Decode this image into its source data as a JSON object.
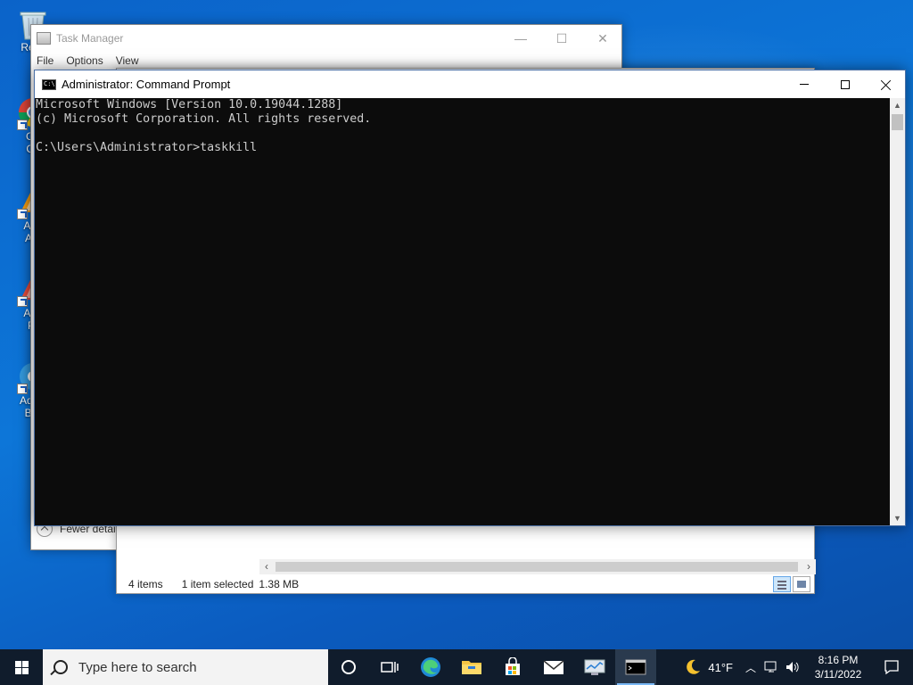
{
  "desktop": {
    "icons": [
      {
        "label": "Recy"
      },
      {
        "label": "Go",
        "label2": "Ch"
      },
      {
        "label": "Ada",
        "label2": "Ant"
      },
      {
        "label": "Ada",
        "label2": "Pr"
      },
      {
        "label": "Adaw",
        "label2": "Bro"
      }
    ]
  },
  "task_manager": {
    "title": "Task Manager",
    "menu": [
      "File",
      "Options",
      "View"
    ],
    "fewer_details": "Fewer detai"
  },
  "explorer": {
    "status": {
      "items": "4 items",
      "selected": "1 item selected",
      "size": "1.38 MB"
    }
  },
  "cmd": {
    "title": "Administrator: Command Prompt",
    "lines": [
      "Microsoft Windows [Version 10.0.19044.1288]",
      "(c) Microsoft Corporation. All rights reserved.",
      "",
      "C:\\Users\\Administrator>taskkill"
    ]
  },
  "taskbar": {
    "search_placeholder": "Type here to search",
    "weather": "41°F",
    "time": "8:16 PM",
    "date": "3/11/2022"
  },
  "colors": {
    "console_bg": "#0c0c0c",
    "console_fg": "#cccccc",
    "taskbar_bg": "#101c2c",
    "desktop_blue": "#0b63c9"
  }
}
